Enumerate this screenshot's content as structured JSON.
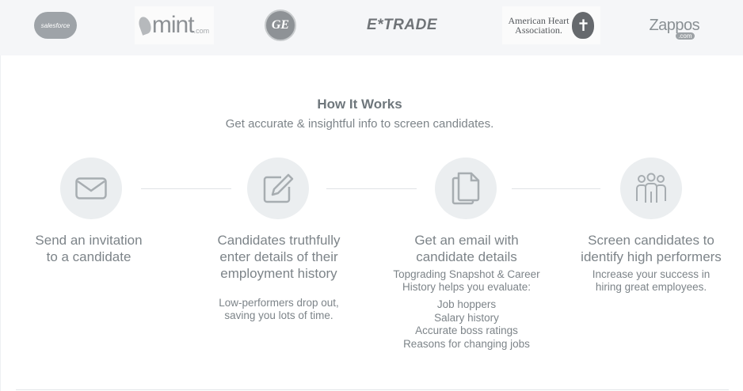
{
  "logos": {
    "salesforce": "salesforce",
    "mint": "mint",
    "mint_suffix": ".com",
    "ge": "GE",
    "etrade": "E*TRADE",
    "aha_line1": "American Heart",
    "aha_line2": "Association.",
    "zappos": "Zappos",
    "zappos_suffix": ".com"
  },
  "section": {
    "title": "How It Works",
    "subtitle": "Get accurate & insightful info to screen candidates."
  },
  "steps": [
    {
      "icon": "envelope-icon",
      "title_line1": "Send an invitation",
      "title_line2": "to a candidate"
    },
    {
      "icon": "edit-icon",
      "title_line1": "Candidates truthfully",
      "title_line2": "enter details of their",
      "title_line3": "employment history",
      "desc_line1": "Low-performers drop out,",
      "desc_line2": "saving you lots of time."
    },
    {
      "icon": "documents-icon",
      "title_line1": "Get an email with",
      "title_line2": "candidate details",
      "desc_line1": "Topgrading Snapshot & Career",
      "desc_line2": "History helps you evaluate:",
      "list": [
        "Job hoppers",
        "Salary history",
        "Accurate boss ratings",
        "Reasons for changing jobs"
      ]
    },
    {
      "icon": "people-icon",
      "title_line1": "Screen candidates to",
      "title_line2": "identify high performers",
      "desc_line1": "Increase your success in",
      "desc_line2": "hiring great employees."
    }
  ],
  "colors": {
    "logo_bar": "#f5f6f8",
    "circle": "#ebeef0",
    "text": "#7d8489",
    "icon": "#a7adb1"
  }
}
